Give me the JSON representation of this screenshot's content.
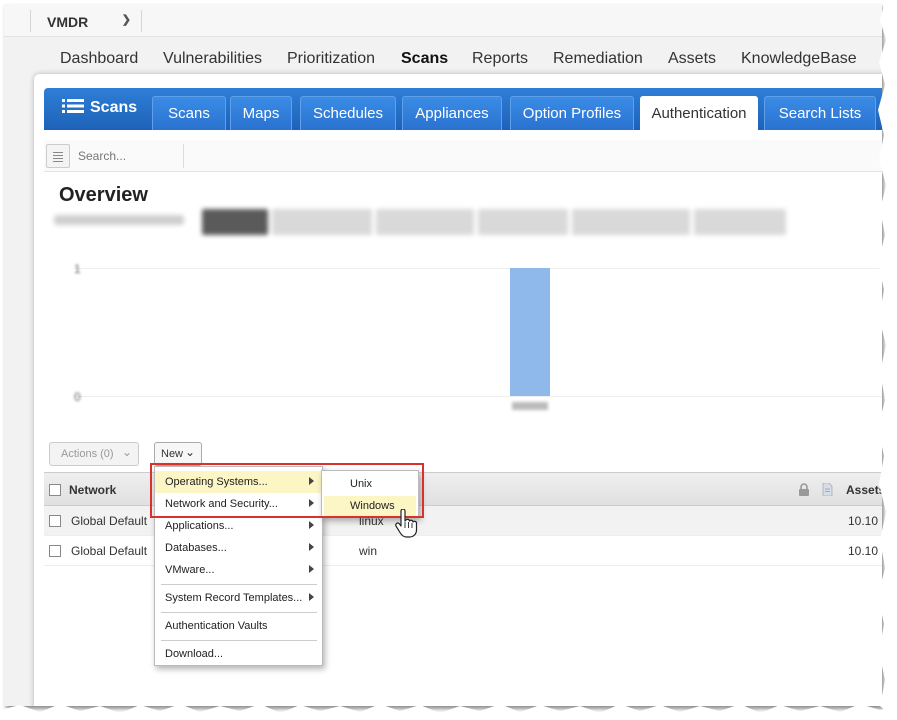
{
  "app": {
    "module": "VMDR"
  },
  "main_nav": [
    {
      "label": "Dashboard",
      "active": false
    },
    {
      "label": "Vulnerabilities",
      "active": false
    },
    {
      "label": "Prioritization",
      "active": false
    },
    {
      "label": "Scans",
      "active": true
    },
    {
      "label": "Reports",
      "active": false
    },
    {
      "label": "Remediation",
      "active": false
    },
    {
      "label": "Assets",
      "active": false
    },
    {
      "label": "KnowledgeBase",
      "active": false
    }
  ],
  "section": {
    "title": "Scans",
    "icon": "list-icon"
  },
  "tabs": [
    {
      "label": "Scans",
      "active": false
    },
    {
      "label": "Maps",
      "active": false
    },
    {
      "label": "Schedules",
      "active": false
    },
    {
      "label": "Appliances",
      "active": false
    },
    {
      "label": "Option Profiles",
      "active": false
    },
    {
      "label": "Authentication",
      "active": true
    },
    {
      "label": "Search Lists",
      "active": false
    }
  ],
  "search": {
    "placeholder": "Search..."
  },
  "overview": {
    "title": "Overview",
    "chart_ticks": [
      "1",
      "0"
    ]
  },
  "actions": {
    "label": "Actions (0)"
  },
  "new_button": {
    "label": "New"
  },
  "table": {
    "headers": {
      "network": "Network",
      "assets": "Assets"
    },
    "rows": [
      {
        "network": "Global Default",
        "type": "linux",
        "assets": "10.10",
        "selected": true
      },
      {
        "network": "Global Default",
        "type": "win",
        "assets": "10.10",
        "selected": false
      }
    ]
  },
  "new_menu": {
    "items": [
      {
        "label": "Operating Systems...",
        "submenu": true,
        "highlighted": true
      },
      {
        "label": "Network and Security...",
        "submenu": true,
        "highlighted": false
      },
      {
        "label": "Applications...",
        "submenu": true,
        "highlighted": false
      },
      {
        "label": "Databases...",
        "submenu": true,
        "highlighted": false
      },
      {
        "label": "VMware...",
        "submenu": true,
        "highlighted": false
      },
      {
        "label": "System Record Templates...",
        "submenu": true,
        "highlighted": false
      },
      {
        "label": "Authentication Vaults",
        "submenu": false,
        "highlighted": false
      },
      {
        "label": "Download...",
        "submenu": false,
        "highlighted": false
      }
    ],
    "os_submenu": [
      {
        "label": "Unix",
        "highlighted": false
      },
      {
        "label": "Windows",
        "highlighted": true
      }
    ]
  },
  "colors": {
    "tab_blue": "#1d62b8",
    "highlight": "#fbf6c4",
    "callout_red": "#d9322c",
    "bar_blue": "#8fb9ea"
  }
}
